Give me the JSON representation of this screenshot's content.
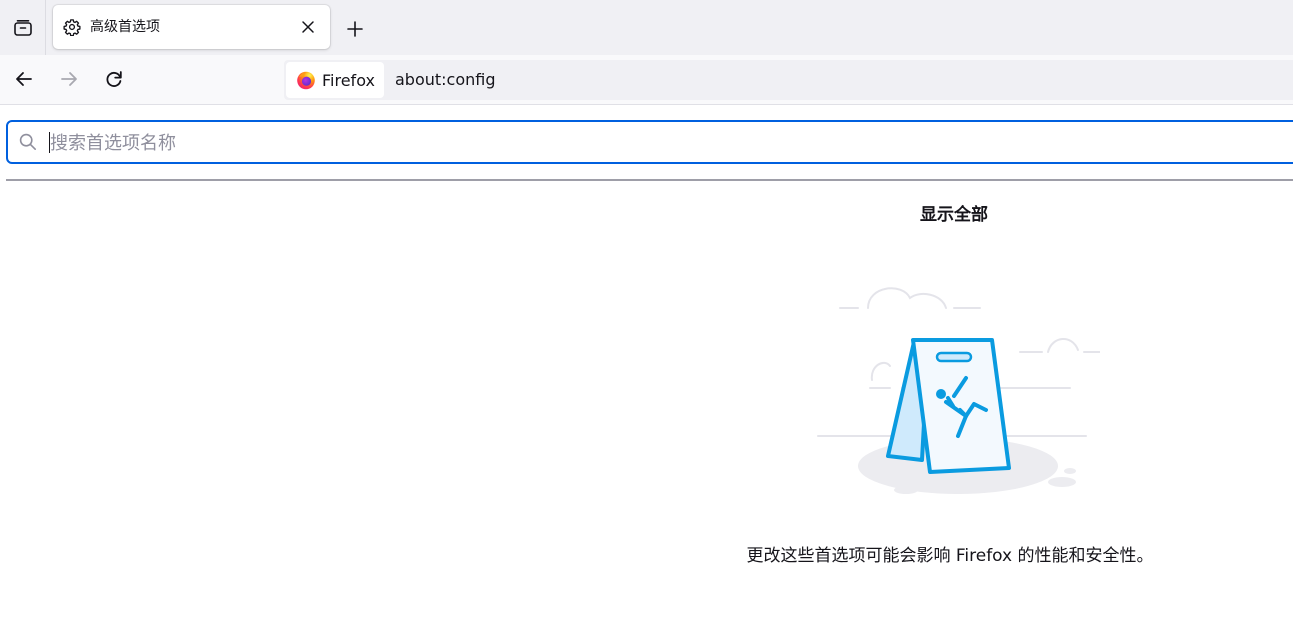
{
  "browser": {
    "tab": {
      "title": "高级首选项"
    },
    "urlbar": {
      "identity_label": "Firefox",
      "url": "about:config"
    }
  },
  "config_page": {
    "search": {
      "placeholder": "搜索首选项名称",
      "value": ""
    },
    "show_all_label": "显示全部",
    "warning_text": "更改这些首选项可能会影响 Firefox 的性能和安全性。"
  },
  "icons": {
    "tab_manager": "tab-manager-icon",
    "tab_favicon": "gear-icon",
    "tab_close": "close-icon",
    "new_tab": "plus-icon",
    "back": "arrow-left-icon",
    "forward": "arrow-right-icon",
    "reload": "reload-icon",
    "identity": "firefox-logo-icon",
    "search": "search-icon"
  },
  "colors": {
    "accent": "#0060df",
    "illustration_blue": "#0a9be0",
    "illustration_light_blue": "#cfeafc"
  }
}
